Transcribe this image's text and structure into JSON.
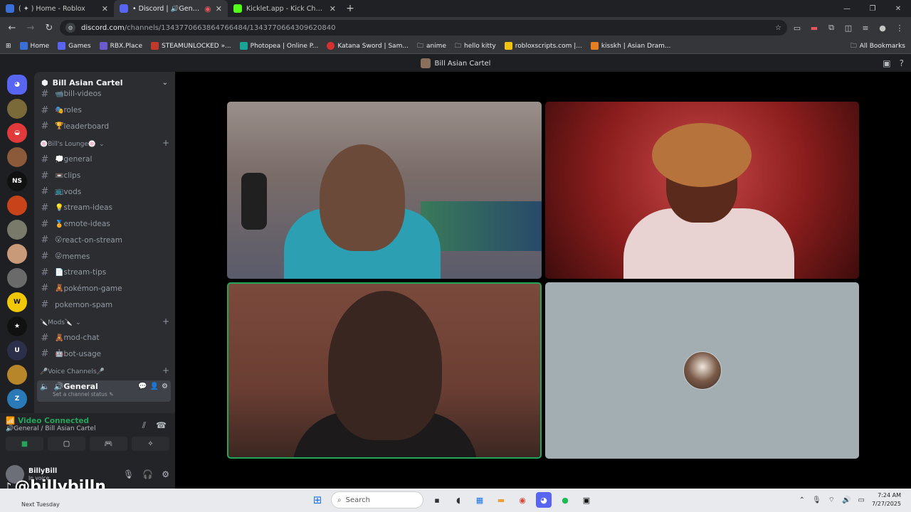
{
  "browser": {
    "tabs": [
      {
        "title": "( ✦ ) Home - Roblox",
        "color": "#3b6fd8"
      },
      {
        "title": "• Discord | 🔊General | Bill Asian Cartel",
        "color": "#5865f2"
      },
      {
        "title": "Kicklet.app - Kick Chatbot and",
        "color": "#53fc18"
      }
    ],
    "new_tab": "+",
    "url_main": "discord.com",
    "url_rest": "/channels/1343770663864766484/1343770664309620840",
    "bookmarks": [
      {
        "label": "Home",
        "color": "#3b6fd8"
      },
      {
        "label": "Games",
        "color": "#5865f2"
      },
      {
        "label": "RBX.Place",
        "color": "#6a5acd"
      },
      {
        "label": "STEAMUNLOCKED »...",
        "color": "#c0392b"
      },
      {
        "label": "Photopea | Online P...",
        "color": "#18a497"
      },
      {
        "label": "Katana Sword | Sam...",
        "color": "#d63031"
      },
      {
        "label": "anime",
        "color": "#9aa0a6"
      },
      {
        "label": "hello kitty",
        "color": "#9aa0a6"
      },
      {
        "label": "robloxscripts.com |...",
        "color": "#f1c40f"
      },
      {
        "label": "kisskh | Asian Dram...",
        "color": "#e67e22"
      }
    ],
    "all_bookmarks": "All Bookmarks"
  },
  "discord": {
    "window_title": "Bill Asian Cartel",
    "guild_name": "Bill Asian Cartel",
    "top_channels": [
      {
        "emoji": "📹",
        "name": "bill-videos"
      },
      {
        "emoji": "🎭",
        "name": "roles"
      },
      {
        "emoji": "🏆",
        "name": "leaderboard"
      }
    ],
    "lounge_category": "🍥Bill's Lounge🍥",
    "lounge_channels": [
      {
        "emoji": "💭",
        "name": "general"
      },
      {
        "emoji": "📼",
        "name": "clips"
      },
      {
        "emoji": "📺",
        "name": "vods"
      },
      {
        "emoji": "💡",
        "name": "stream-ideas"
      },
      {
        "emoji": "🏅",
        "name": "emote-ideas"
      },
      {
        "emoji": "😮",
        "name": "react-on-stream"
      },
      {
        "emoji": "😜",
        "name": "memes"
      },
      {
        "emoji": "📄",
        "name": "stream-tips"
      },
      {
        "emoji": "🧸",
        "name": "pokémon-game"
      },
      {
        "emoji": "",
        "name": "pokemon-spam"
      }
    ],
    "mods_category": "🔪Mods🔪",
    "mods_channels": [
      {
        "emoji": "🧸",
        "name": "mod-chat"
      },
      {
        "emoji": "🤖",
        "name": "bot-usage"
      }
    ],
    "voice_category": "🎤Voice Channels🎤",
    "voice_channel": {
      "name": "🔊General",
      "status": "Set a channel status"
    },
    "voice_panel": {
      "status": "Video Connected",
      "location": "🔊General / Bill Asian Cartel"
    },
    "user": {
      "name": "BillyBill",
      "status": "In voice"
    },
    "watermark": "@billybilln"
  },
  "taskbar": {
    "weather_line1": "Next Tuesday",
    "search_placeholder": "Search",
    "time": "7:24 AM",
    "date": "7/27/2025"
  },
  "colors": {
    "connected": "#23a55a",
    "speaking_border": "#23a55a"
  }
}
